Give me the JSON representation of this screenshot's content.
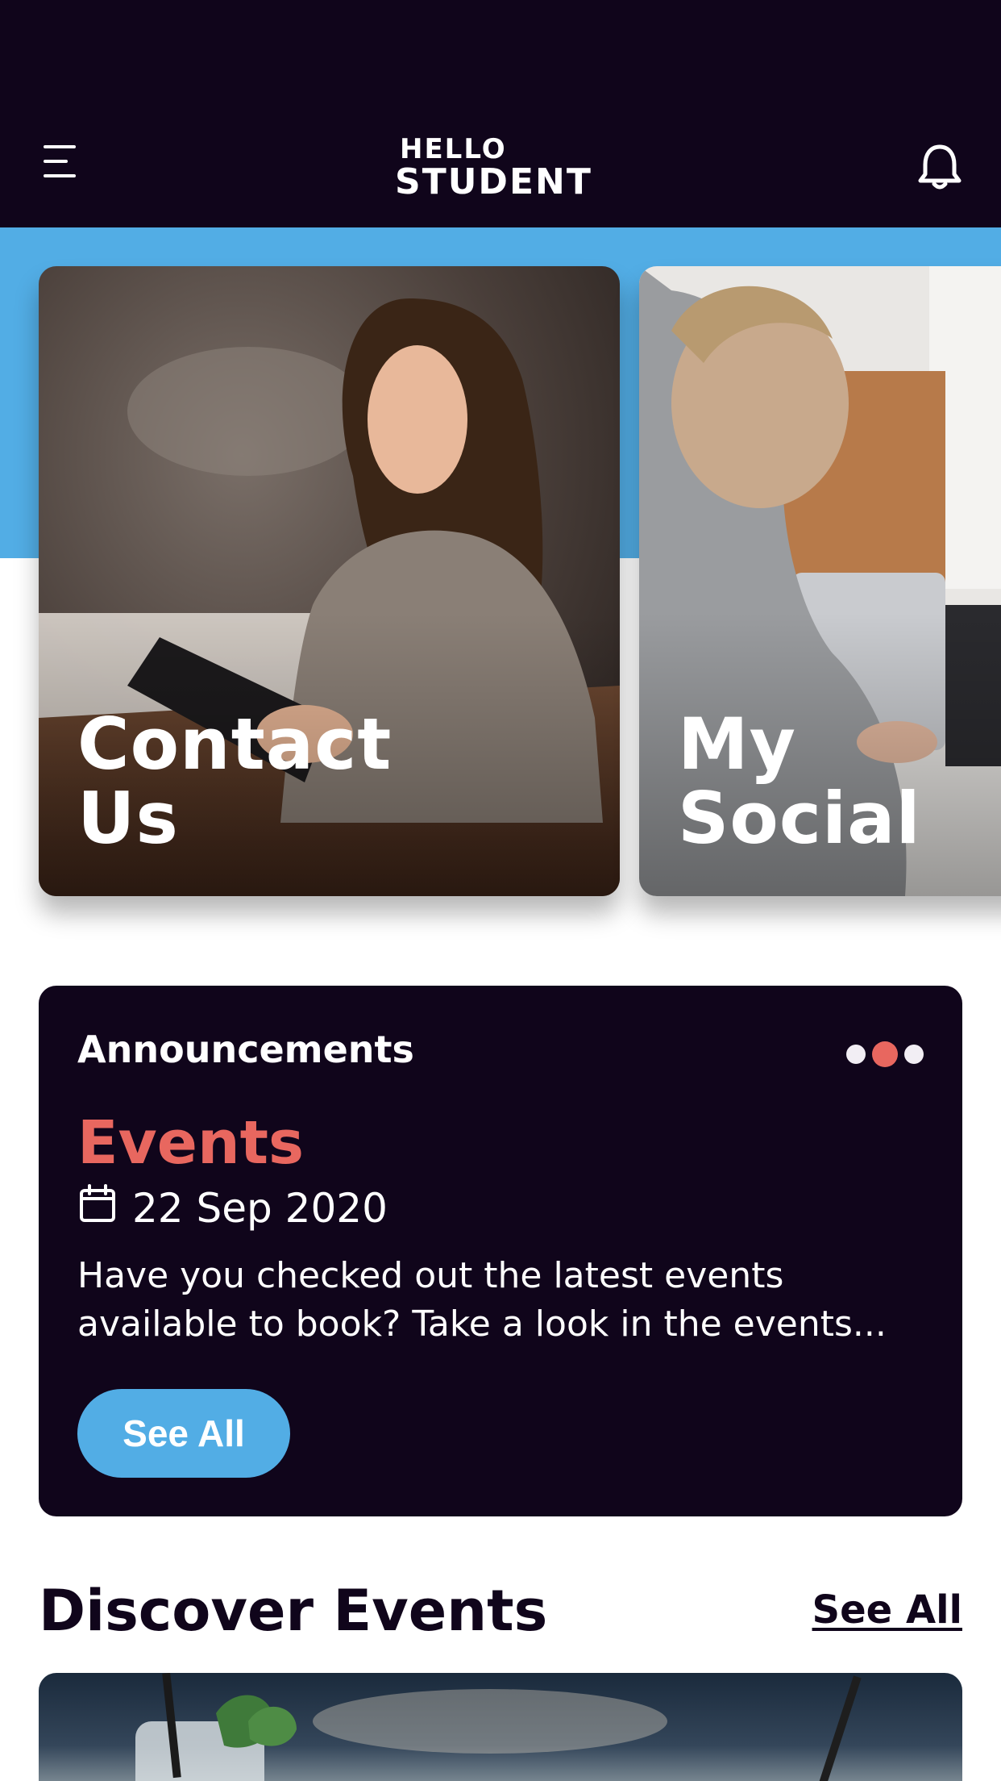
{
  "header": {
    "logo_line1": "HELLO",
    "logo_line2": "STUDENT",
    "menu_icon": "hamburger-menu-icon",
    "notification_icon": "bell-icon"
  },
  "colors": {
    "navy": "#10051b",
    "sky_blue": "#52ade5",
    "coral": "#e8675f",
    "white": "#ffffff"
  },
  "featured_cards": [
    {
      "title": "Contact\nUs"
    },
    {
      "title": "My\nSocial"
    }
  ],
  "announcements": {
    "heading": "Announcements",
    "carousel_total": 3,
    "carousel_active": 2,
    "category": "Events",
    "date_icon": "calendar-icon",
    "date": "22 Sep 2020",
    "text": "Have you checked out the latest events available to book? Take a look in the events...",
    "button_label": "See All"
  },
  "discover_events": {
    "heading": "Discover Events",
    "see_all_label": "See All"
  }
}
